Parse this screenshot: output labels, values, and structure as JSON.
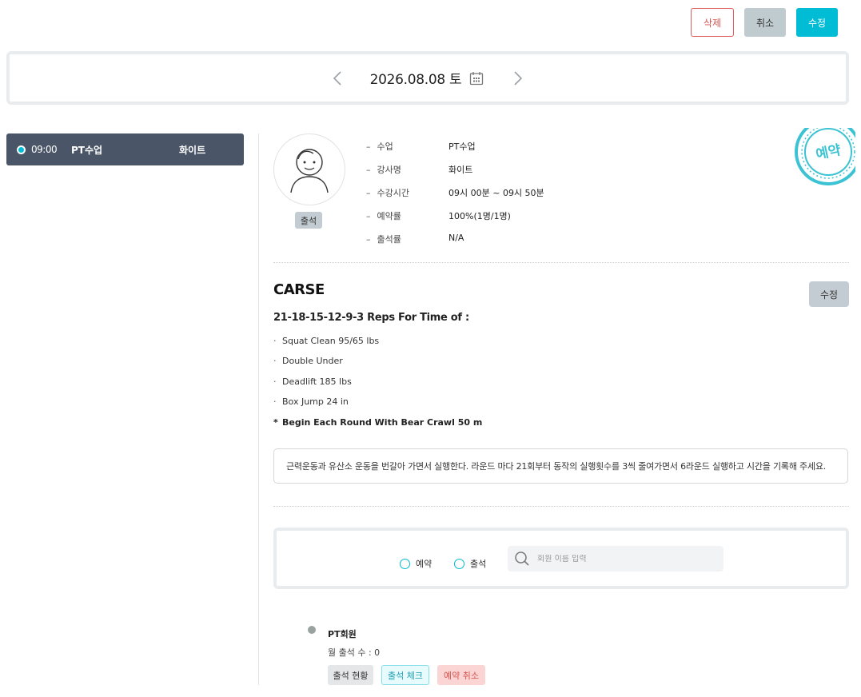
{
  "toolbar": {
    "delete_label": "삭제",
    "cancel_label": "취소",
    "edit_label": "수정"
  },
  "date_nav": {
    "date": "2026.08.08 토",
    "prev_icon": "chevron-left-icon",
    "next_icon": "chevron-right-icon",
    "calendar_icon": "calendar-icon"
  },
  "schedule": [
    {
      "time": "09:00",
      "class": "PT수업",
      "teacher": "화이트",
      "status_color": "#00bcd4"
    }
  ],
  "class_info": {
    "attend_badge": "출석",
    "rows": [
      {
        "label": "수업",
        "value": "PT수업"
      },
      {
        "label": "강사명",
        "value": "화이트"
      },
      {
        "label": "수강시간",
        "value": "09시 00분 ~ 09시 50분"
      },
      {
        "label": "예약률",
        "value": "100%(1명/1명)"
      },
      {
        "label": "출석률",
        "value": "N/A"
      }
    ],
    "stamp_text": "예약"
  },
  "workout": {
    "title": "CARSE",
    "edit_label": "수정",
    "subtitle": "21-18-15-12-9-3 Reps For Time of :",
    "items": [
      "Squat Clean 95/65 lbs",
      "Double Under",
      "Deadlift 185 lbs",
      "Box Jump 24 in"
    ],
    "note_marker": "*",
    "item_bullet": "·",
    "note": "Begin Each Round With Bear Crawl 50 m",
    "description": "근력운동과 유산소 운동을 번갈아 가면서 실행한다. 라운드 마다 21회부터 동작의 실행횟수를 3씩 줄여가면서 6라운드 실행하고 시간을 기록해 주세요."
  },
  "filter": {
    "radio_reserve": "예약",
    "radio_attend": "출석",
    "search_placeholder": "회원 이름 입력"
  },
  "members": [
    {
      "name": "PT회원",
      "monthly_attendance": "월 출석 수 : 0",
      "btn_status": "출석 현황",
      "btn_check": "출석 체크",
      "btn_cancel": "예약 취소"
    }
  ],
  "colors": {
    "accent": "#00bcd4",
    "danger": "#d9534f",
    "schedule_bg": "#4a5568"
  }
}
